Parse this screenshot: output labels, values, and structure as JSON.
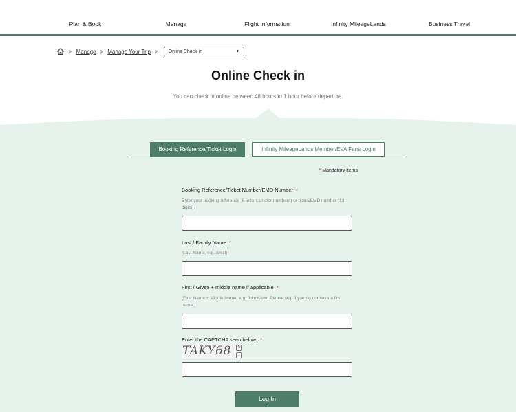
{
  "nav": {
    "items": [
      {
        "label": "Plan & Book"
      },
      {
        "label": "Manage"
      },
      {
        "label": "Flight Information"
      },
      {
        "label": "Infinity MileageLands"
      },
      {
        "label": "Business Travel"
      }
    ]
  },
  "breadcrumb": {
    "sep": ">",
    "items": [
      "Manage",
      "Manage Your Trip"
    ],
    "select_value": "Online Check in"
  },
  "page": {
    "title": "Online Check in",
    "subtitle": "You can check in online between 48 hours to 1 hour before departure."
  },
  "tabs": [
    {
      "label": "Booking Reference/Ticket Login",
      "active": true
    },
    {
      "label": "Infinity MileageLands Member/EVA Fans Login",
      "active": false
    }
  ],
  "form": {
    "mandatory_star": "*",
    "mandatory_note": "Mandatory items",
    "required_mark": "*",
    "fields": [
      {
        "label": "Booking Reference/Ticket Number/EMD Number",
        "hint": "Enter your booking reference (6 letters and/or numbers) or ticket/EMD number (13 digits).",
        "value": ""
      },
      {
        "label": "Last / Family Name",
        "hint": "(Last Name, e.g. Smith)",
        "value": ""
      },
      {
        "label": "First / Given + middle name if applicable",
        "hint": "(First Name + Middle Name, e.g. JohnKevin.Please skip if you do not have a first name.)",
        "value": ""
      },
      {
        "label": "Enter the CAPTCHA seen below:",
        "value": ""
      }
    ],
    "captcha_text": "TAKY68",
    "login_label": "Log In"
  },
  "colors": {
    "brand": "#4e7e6b",
    "mint_bg": "#e6f3ed",
    "required": "#c0392b"
  },
  "icons": {
    "home": "home-icon",
    "refresh": "refresh-icon",
    "audio": "audio-icon"
  }
}
